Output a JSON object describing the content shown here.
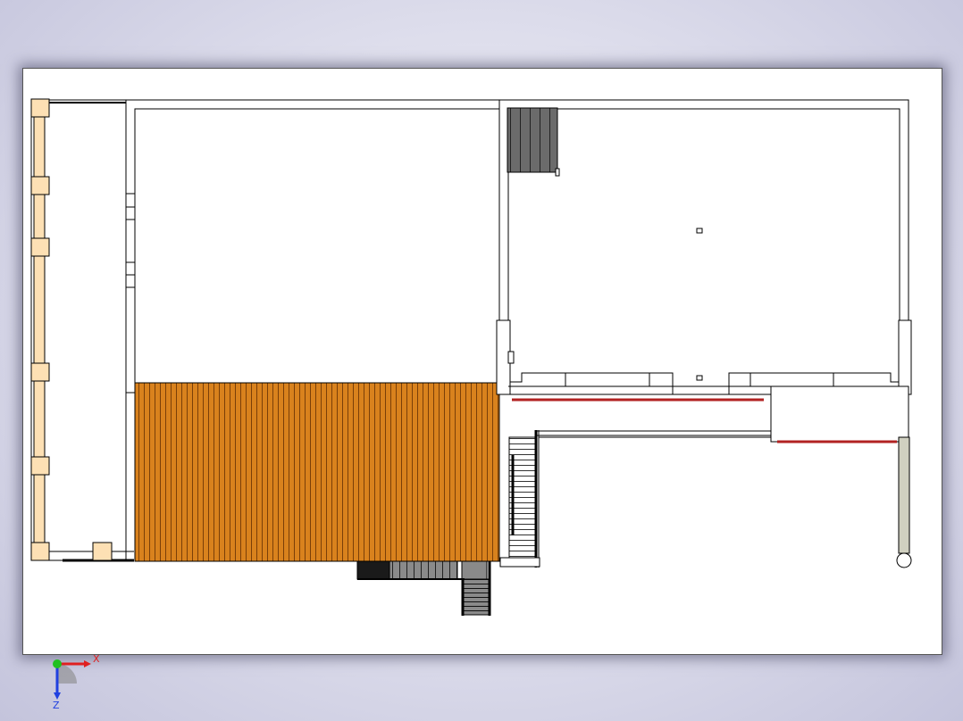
{
  "view": {
    "background": "#d8d8ec",
    "sheet_color": "#ffffff"
  },
  "colors": {
    "deck_wood": "#d9821d",
    "deck_slat_line": "#7a3f08",
    "column_fill": "#fde0b4",
    "stair_dark": "#6b6b6b",
    "stair_black": "#1a1a1a",
    "red_trim": "#b22222",
    "post_fill": "#d0d0c0",
    "wall_line": "#000000"
  },
  "triad": {
    "x_label": "X",
    "z_label": "Z",
    "x_color": "#e02020",
    "y_color": "#20c020",
    "z_color": "#2040e0"
  },
  "icons": {
    "triad": "reference-triad-icon"
  }
}
